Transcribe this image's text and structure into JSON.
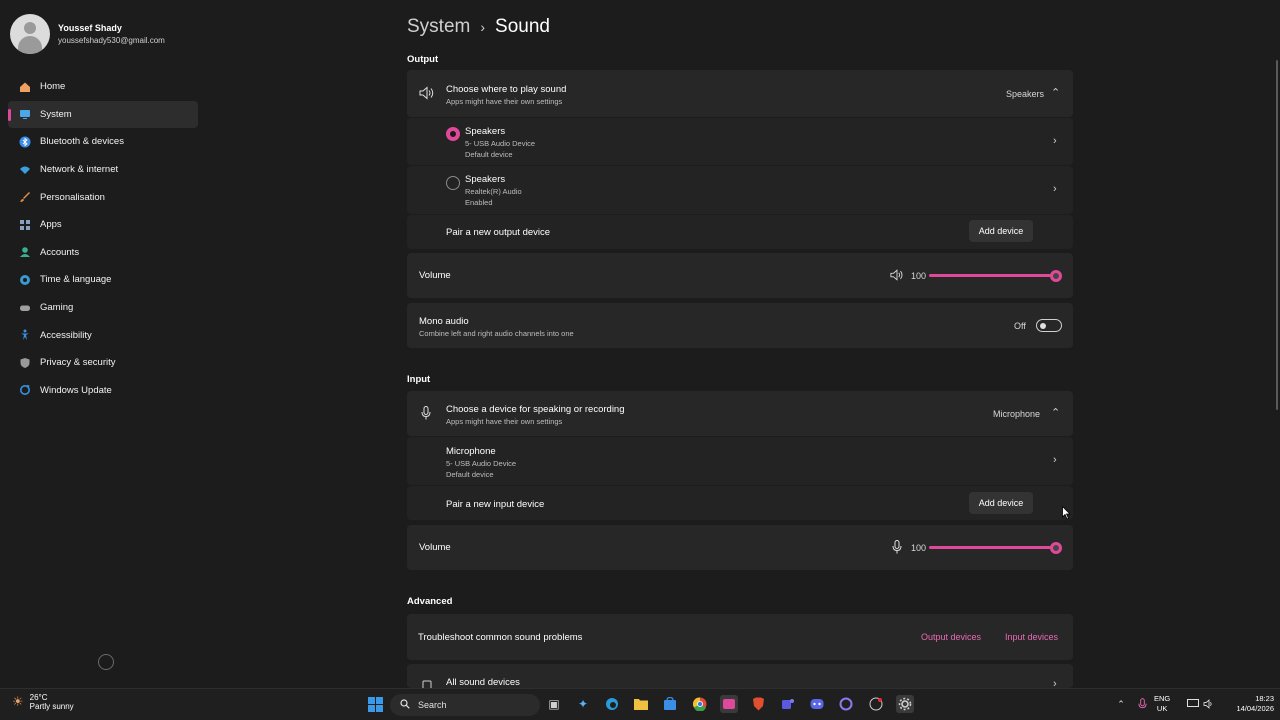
{
  "profile": {
    "name": "Youssef Shady",
    "email": "youssefshady530@gmail.com"
  },
  "nav": {
    "items": [
      {
        "label": "Home",
        "icon": "home-icon",
        "color": "#f0a060"
      },
      {
        "label": "System",
        "icon": "system-icon",
        "color": "#4aa8e8"
      },
      {
        "label": "Bluetooth & devices",
        "icon": "bluetooth-icon",
        "color": "#3a8ee6"
      },
      {
        "label": "Network & internet",
        "icon": "wifi-icon",
        "color": "#3aa0e0"
      },
      {
        "label": "Personalisation",
        "icon": "brush-icon",
        "color": "#e0904a"
      },
      {
        "label": "Apps",
        "icon": "apps-icon",
        "color": "#8aa0c0"
      },
      {
        "label": "Accounts",
        "icon": "accounts-icon",
        "color": "#3ab090"
      },
      {
        "label": "Time & language",
        "icon": "globe-icon",
        "color": "#3a9ad0"
      },
      {
        "label": "Gaming",
        "icon": "gaming-icon",
        "color": "#a0a0a0"
      },
      {
        "label": "Accessibility",
        "icon": "accessibility-icon",
        "color": "#3a90e0"
      },
      {
        "label": "Privacy & security",
        "icon": "shield-icon",
        "color": "#9a9a9a"
      },
      {
        "label": "Windows Update",
        "icon": "update-icon",
        "color": "#3a90e0"
      }
    ],
    "active": "System"
  },
  "breadcrumb": {
    "parent": "System",
    "separator": "›",
    "current": "Sound"
  },
  "output": {
    "section_label": "Output",
    "choose_title": "Choose where to play sound",
    "choose_sub": "Apps might have their own settings",
    "selected_value": "Speakers",
    "devices": [
      {
        "name": "Speakers",
        "detail": "5- USB Audio Device",
        "status": "Default device",
        "selected": true
      },
      {
        "name": "Speakers",
        "detail": "Realtek(R) Audio",
        "status": "Enabled",
        "selected": false
      }
    ],
    "pair_label": "Pair a new output device",
    "add_button": "Add device",
    "volume_label": "Volume",
    "volume_value": "100",
    "mono_title": "Mono audio",
    "mono_sub": "Combine left and right audio channels into one",
    "mono_state": "Off"
  },
  "input": {
    "section_label": "Input",
    "choose_title": "Choose a device for speaking or recording",
    "choose_sub": "Apps might have their own settings",
    "selected_value": "Microphone",
    "devices": [
      {
        "name": "Microphone",
        "detail": "5- USB Audio Device",
        "status": "Default device"
      }
    ],
    "pair_label": "Pair a new input device",
    "add_button": "Add device",
    "volume_label": "Volume",
    "volume_value": "100"
  },
  "advanced": {
    "section_label": "Advanced",
    "troubleshoot_label": "Troubleshoot common sound problems",
    "output_devices_link": "Output devices",
    "input_devices_link": "Input devices",
    "all_devices_label": "All sound devices"
  },
  "taskbar": {
    "weather_temp": "26°C",
    "weather_desc": "Partly sunny",
    "search_placeholder": "Search",
    "lang_top": "ENG",
    "lang_bottom": "UK",
    "time": "18:23",
    "date": "14/04/2026"
  },
  "colors": {
    "accent": "#e0489a"
  }
}
